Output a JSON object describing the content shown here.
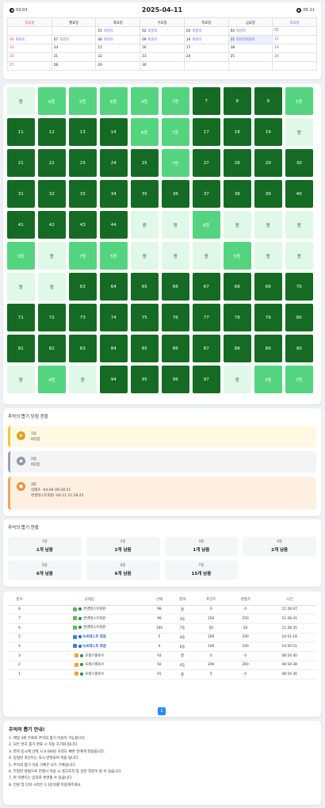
{
  "calendar": {
    "prev_label": "03-03",
    "next_label": "05-11",
    "title": "2025-04-11",
    "weekdays": [
      "일요일",
      "월요일",
      "화요일",
      "수요일",
      "목요일",
      "금요일",
      "토요일"
    ],
    "rows": [
      [
        {
          "d": "",
          "e": ""
        },
        {
          "d": "",
          "e": ""
        },
        {
          "d": "01",
          "e": "회원의"
        },
        {
          "d": "02",
          "e": "회원의"
        },
        {
          "d": "03",
          "e": "회원의"
        },
        {
          "d": "04",
          "e": "회원의"
        },
        {
          "d": "05",
          "e": ""
        }
      ],
      [
        {
          "d": "06",
          "e": "회원의"
        },
        {
          "d": "07",
          "e": "회원의"
        },
        {
          "d": "08",
          "e": "회원의"
        },
        {
          "d": "09",
          "e": "회원의"
        },
        {
          "d": "10",
          "e": "회원의"
        },
        {
          "d": "11",
          "e": "회원의회원의"
        },
        {
          "d": "12",
          "e": ""
        }
      ],
      [
        {
          "d": "13",
          "e": ""
        },
        {
          "d": "14",
          "e": ""
        },
        {
          "d": "15",
          "e": ""
        },
        {
          "d": "16",
          "e": ""
        },
        {
          "d": "17",
          "e": ""
        },
        {
          "d": "18",
          "e": ""
        },
        {
          "d": "19",
          "e": ""
        }
      ],
      [
        {
          "d": "20",
          "e": ""
        },
        {
          "d": "21",
          "e": ""
        },
        {
          "d": "22",
          "e": ""
        },
        {
          "d": "23",
          "e": ""
        },
        {
          "d": "24",
          "e": ""
        },
        {
          "d": "25",
          "e": ""
        },
        {
          "d": "26",
          "e": ""
        }
      ],
      [
        {
          "d": "27",
          "e": ""
        },
        {
          "d": "28",
          "e": ""
        },
        {
          "d": "29",
          "e": ""
        },
        {
          "d": "30",
          "e": ""
        },
        {
          "d": "",
          "e": ""
        },
        {
          "d": "",
          "e": ""
        },
        {
          "d": "",
          "e": ""
        }
      ]
    ]
  },
  "grid": {
    "cells": [
      {
        "t": "꽝",
        "s": "l"
      },
      {
        "t": "6등",
        "s": "m"
      },
      {
        "t": "5등",
        "s": "m"
      },
      {
        "t": "6등",
        "s": "m"
      },
      {
        "t": "4등",
        "s": "m"
      },
      {
        "t": "7등",
        "s": "m"
      },
      {
        "t": "7",
        "s": "d"
      },
      {
        "t": "8",
        "s": "d"
      },
      {
        "t": "9",
        "s": "d"
      },
      {
        "t": "5등",
        "s": "m"
      },
      {
        "t": "11",
        "s": "d"
      },
      {
        "t": "12",
        "s": "d"
      },
      {
        "t": "13",
        "s": "d"
      },
      {
        "t": "14",
        "s": "d"
      },
      {
        "t": "6등",
        "s": "m"
      },
      {
        "t": "7등",
        "s": "m"
      },
      {
        "t": "17",
        "s": "d"
      },
      {
        "t": "18",
        "s": "d"
      },
      {
        "t": "19",
        "s": "d"
      },
      {
        "t": "꽝",
        "s": "l"
      },
      {
        "t": "21",
        "s": "d"
      },
      {
        "t": "22",
        "s": "d"
      },
      {
        "t": "23",
        "s": "d"
      },
      {
        "t": "24",
        "s": "d"
      },
      {
        "t": "25",
        "s": "d"
      },
      {
        "t": "7등",
        "s": "m"
      },
      {
        "t": "27",
        "s": "d"
      },
      {
        "t": "28",
        "s": "d"
      },
      {
        "t": "29",
        "s": "d"
      },
      {
        "t": "30",
        "s": "d"
      },
      {
        "t": "31",
        "s": "d"
      },
      {
        "t": "32",
        "s": "d"
      },
      {
        "t": "33",
        "s": "d"
      },
      {
        "t": "34",
        "s": "d"
      },
      {
        "t": "35",
        "s": "d"
      },
      {
        "t": "36",
        "s": "d"
      },
      {
        "t": "37",
        "s": "d"
      },
      {
        "t": "38",
        "s": "d"
      },
      {
        "t": "39",
        "s": "d"
      },
      {
        "t": "40",
        "s": "d"
      },
      {
        "t": "41",
        "s": "d"
      },
      {
        "t": "42",
        "s": "d"
      },
      {
        "t": "43",
        "s": "d"
      },
      {
        "t": "44",
        "s": "d"
      },
      {
        "t": "꽝",
        "s": "l"
      },
      {
        "t": "꽝",
        "s": "l"
      },
      {
        "t": "6등",
        "s": "m"
      },
      {
        "t": "꽝",
        "s": "l"
      },
      {
        "t": "꽝",
        "s": "l"
      },
      {
        "t": "꽝",
        "s": "l"
      },
      {
        "t": "3등",
        "s": "m"
      },
      {
        "t": "꽝",
        "s": "l"
      },
      {
        "t": "7등",
        "s": "m"
      },
      {
        "t": "5등",
        "s": "m"
      },
      {
        "t": "꽝",
        "s": "l"
      },
      {
        "t": "꽝",
        "s": "l"
      },
      {
        "t": "꽝",
        "s": "l"
      },
      {
        "t": "5등",
        "s": "m"
      },
      {
        "t": "꽝",
        "s": "l"
      },
      {
        "t": "꽝",
        "s": "l"
      },
      {
        "t": "꽝",
        "s": "l"
      },
      {
        "t": "꽝",
        "s": "l"
      },
      {
        "t": "63",
        "s": "d"
      },
      {
        "t": "64",
        "s": "d"
      },
      {
        "t": "65",
        "s": "d"
      },
      {
        "t": "66",
        "s": "d"
      },
      {
        "t": "67",
        "s": "d"
      },
      {
        "t": "68",
        "s": "d"
      },
      {
        "t": "69",
        "s": "d"
      },
      {
        "t": "70",
        "s": "d"
      },
      {
        "t": "71",
        "s": "d"
      },
      {
        "t": "72",
        "s": "d"
      },
      {
        "t": "73",
        "s": "d"
      },
      {
        "t": "74",
        "s": "d"
      },
      {
        "t": "75",
        "s": "d"
      },
      {
        "t": "76",
        "s": "d"
      },
      {
        "t": "77",
        "s": "d"
      },
      {
        "t": "78",
        "s": "d"
      },
      {
        "t": "79",
        "s": "d"
      },
      {
        "t": "80",
        "s": "d"
      },
      {
        "t": "81",
        "s": "d"
      },
      {
        "t": "82",
        "s": "d"
      },
      {
        "t": "83",
        "s": "d"
      },
      {
        "t": "84",
        "s": "d"
      },
      {
        "t": "85",
        "s": "d"
      },
      {
        "t": "86",
        "s": "d"
      },
      {
        "t": "87",
        "s": "d"
      },
      {
        "t": "88",
        "s": "d"
      },
      {
        "t": "89",
        "s": "d"
      },
      {
        "t": "90",
        "s": "d"
      },
      {
        "t": "꽝",
        "s": "l"
      },
      {
        "t": "4등",
        "s": "m"
      },
      {
        "t": "꽝",
        "s": "l"
      },
      {
        "t": "94",
        "s": "d"
      },
      {
        "t": "95",
        "s": "d"
      },
      {
        "t": "96",
        "s": "d"
      },
      {
        "t": "97",
        "s": "d"
      },
      {
        "t": "꽝",
        "s": "l"
      },
      {
        "t": "3등",
        "s": "m"
      },
      {
        "t": "7등",
        "s": "m"
      }
    ]
  },
  "winners": {
    "title": "추억의 뽑기 당첨 현황",
    "first": {
      "rank": "1등",
      "line1": "0당첨"
    },
    "second": {
      "rank": "2등",
      "line1": "0당첨"
    },
    "third": {
      "rank": "3등",
      "line1": "김레츠 -04-04 09:28:51",
      "line2": "변경테스트회원 -04-11 11:28:41"
    }
  },
  "status": {
    "title": "추억의 뽑기 현황",
    "items": [
      {
        "rank": "1등",
        "remain": "1개 남음"
      },
      {
        "rank": "2등",
        "remain": "2개 남음"
      },
      {
        "rank": "3등",
        "remain": "1개 남음"
      },
      {
        "rank": "4등",
        "remain": "2개 남음"
      },
      {
        "rank": "5등",
        "remain": "6개 남음"
      },
      {
        "rank": "6등",
        "remain": "6개 남음"
      },
      {
        "rank": "7등",
        "remain": "15개 남음"
      }
    ]
  },
  "table": {
    "headers": [
      "번호",
      "닉네임",
      "선택",
      "결과",
      "포인트",
      "경험치",
      "시간"
    ],
    "rows": [
      {
        "no": "8",
        "nick": "변경테스트회원",
        "av": "g",
        "sel": "98",
        "res": "꽝",
        "pt": "0",
        "exp": "0",
        "time": "11:28:47"
      },
      {
        "no": "7",
        "nick": "변경테스트회원",
        "av": "g",
        "sel": "99",
        "res": "3등",
        "pt": "250",
        "exp": "250",
        "time": "11:28:41"
      },
      {
        "no": "6",
        "nick": "변경테스트회원",
        "av": "g",
        "sel": "100",
        "res": "7등",
        "pt": "50",
        "exp": "50",
        "time": "11:28:35"
      },
      {
        "no": "5",
        "nick": "뉴비테스트 회원",
        "av": "b",
        "sel": "5",
        "res": "4등",
        "pt": "200",
        "exp": "200",
        "time": "10:51:18"
      },
      {
        "no": "4",
        "nick": "뉴비테스트 회원",
        "av": "b",
        "sel": "4",
        "res": "6등",
        "pt": "100",
        "exp": "100",
        "time": "10:50:51"
      },
      {
        "no": "3",
        "nick": "포레스텔포브",
        "av": "o",
        "sel": "93",
        "res": "꽝",
        "pt": "0",
        "exp": "0",
        "time": "08:54:40"
      },
      {
        "no": "2",
        "nick": "포레스텔포브",
        "av": "o",
        "sel": "92",
        "res": "4등",
        "pt": "200",
        "exp": "200",
        "time": "08:54:38"
      },
      {
        "no": "1",
        "nick": "포레스텔포브",
        "av": "o",
        "sel": "91",
        "res": "꽝",
        "pt": "0",
        "exp": "0",
        "time": "08:54:36"
      }
    ],
    "page": "1"
  },
  "notice": {
    "title": "추억의 뽑기 안내!",
    "lines": [
      "1. 매일 3회 무료로 추억의 뽑기 이용이 가능합니다.",
      "2. 모든 번호 뽑기 완료 시 자동 초기화 됩니다.",
      "3. 한자 동시에 선택 시 0.0001 초라도 빠른 분에게 적용됩니다.",
      "4. 당첨된 포인트는 즉시 반영되며 적립 됩니다.",
      "5. 추억의 뽑기 이용 기록은 모두 기록됩니다.",
      "6. 부정한 방법으로 진행시 이용 시 경고조치 및 강한 처분이 될 수 있습니다.",
      "7. 본 이벤트는 임의로 변경될 수 있습니다.",
      "8. 전원 및 단의 시작은 1:1문의를 이용해주세요."
    ]
  },
  "colors": {
    "dark": "#156b23",
    "mid": "#55d47f",
    "light": "#e0f8e7",
    "page": "#2b8af2"
  }
}
